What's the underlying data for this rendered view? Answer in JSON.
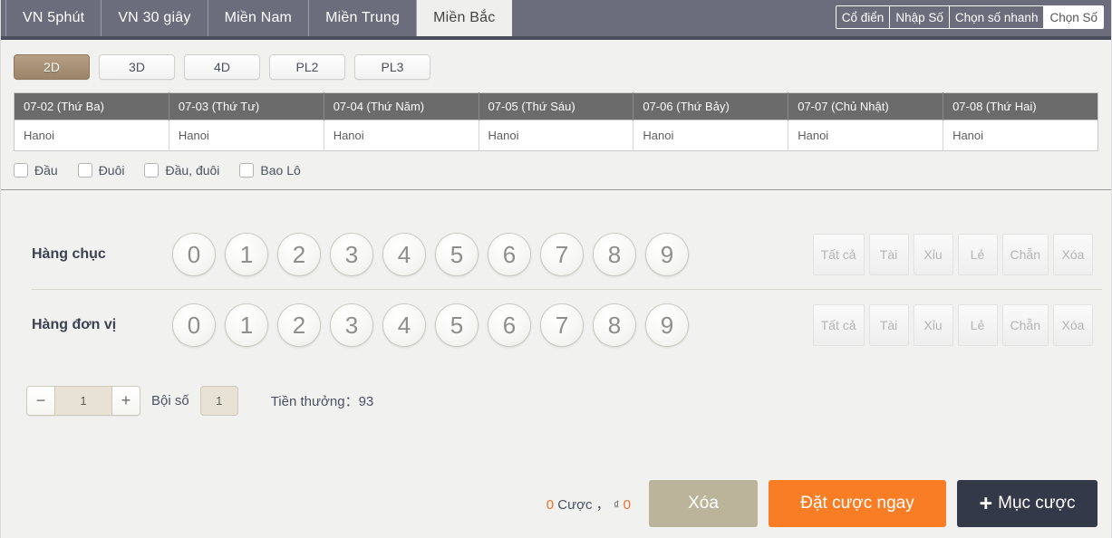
{
  "header": {
    "tabs": [
      {
        "label": "VN 5phút",
        "active": false
      },
      {
        "label": "VN 30 giây",
        "active": false
      },
      {
        "label": "Miền Nam",
        "active": false
      },
      {
        "label": "Miền Trung",
        "active": false
      },
      {
        "label": "Miền Bắc",
        "active": true
      }
    ],
    "modes": [
      {
        "label": "Cổ điển",
        "active": false
      },
      {
        "label": "Nhập Số",
        "active": false
      },
      {
        "label": "Chọn số nhanh",
        "active": false
      },
      {
        "label": "Chọn Số",
        "active": true
      }
    ]
  },
  "playtypes": [
    {
      "label": "2D",
      "active": true
    },
    {
      "label": "3D",
      "active": false
    },
    {
      "label": "4D",
      "active": false
    },
    {
      "label": "PL2",
      "active": false
    },
    {
      "label": "PL3",
      "active": false
    }
  ],
  "schedule": {
    "headers": [
      "07-02 (Thứ Ba)",
      "07-03 (Thứ Tư)",
      "07-04 (Thứ Năm)",
      "07-05 (Thứ Sáu)",
      "07-06 (Thứ Bảy)",
      "07-07 (Chủ Nhật)",
      "07-08 (Thứ Hai)"
    ],
    "row": [
      "Hanoi",
      "Hanoi",
      "Hanoi",
      "Hanoi",
      "Hanoi",
      "Hanoi",
      "Hanoi"
    ]
  },
  "checkboxes": [
    {
      "label": "Đầu",
      "checked": false
    },
    {
      "label": "Đuôi",
      "checked": false
    },
    {
      "label": "Đầu, đuôi",
      "checked": false
    },
    {
      "label": "Bao Lô",
      "checked": false
    }
  ],
  "pick_rows": [
    {
      "label": "Hàng chục",
      "numbers": [
        "0",
        "1",
        "2",
        "3",
        "4",
        "5",
        "6",
        "7",
        "8",
        "9"
      ],
      "quick": [
        "Tất cả",
        "Tài",
        "Xỉu",
        "Lẻ",
        "Chẵn",
        "Xóa"
      ]
    },
    {
      "label": "Hàng đơn vị",
      "numbers": [
        "0",
        "1",
        "2",
        "3",
        "4",
        "5",
        "6",
        "7",
        "8",
        "9"
      ],
      "quick": [
        "Tất cả",
        "Tài",
        "Xỉu",
        "Lẻ",
        "Chẵn",
        "Xóa"
      ]
    }
  ],
  "multiplier": {
    "minus": "−",
    "value": "1",
    "plus": "+",
    "label": "Bội số",
    "box_value": "1",
    "prize_label": "Tiền thưởng：",
    "prize_value": "93"
  },
  "footer": {
    "bet_count": "0",
    "bet_word": "Cược ，",
    "currency": "₫",
    "amount": "0",
    "clear_label": "Xóa",
    "bet_label": "Đặt cược ngay",
    "cart_label": "Mục cược",
    "cart_icon": "plus-icon"
  },
  "colors": {
    "header_bg": "#6b6d7c",
    "accent_orange": "#f97d24",
    "accent_tan": "#bcb49a",
    "accent_dark": "#343949",
    "active_playtype": "#9c8468"
  }
}
